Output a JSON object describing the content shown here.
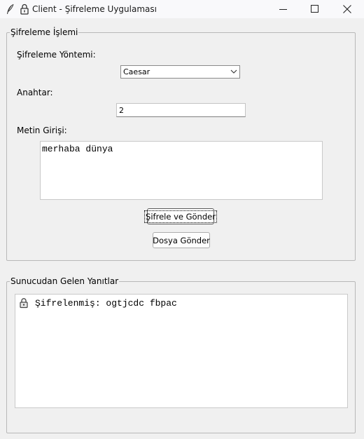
{
  "window": {
    "title": "Client - Şifreleme Uygulaması",
    "icons": [
      "feather-icon",
      "lock-icon"
    ],
    "controls": [
      "minimize-icon",
      "maximize-icon",
      "close-icon"
    ]
  },
  "encrypt_panel": {
    "legend": "Şifreleme İşlemi",
    "method_label": "Şifreleme Yöntemi:",
    "method_value": "Caesar",
    "key_label": "Anahtar:",
    "key_value": "2",
    "text_label": "Metin Girişi:",
    "text_value": "merhaba dünya",
    "encrypt_send_button": "Şifrele ve Gönder",
    "send_file_button": "Dosya Gönder"
  },
  "response_panel": {
    "legend": "Sunucudan Gelen Yanıtlar",
    "lines": [
      {
        "icon": "lock-icon",
        "text": "Şifrelenmiş: ogtjcdc fbpac"
      }
    ]
  }
}
